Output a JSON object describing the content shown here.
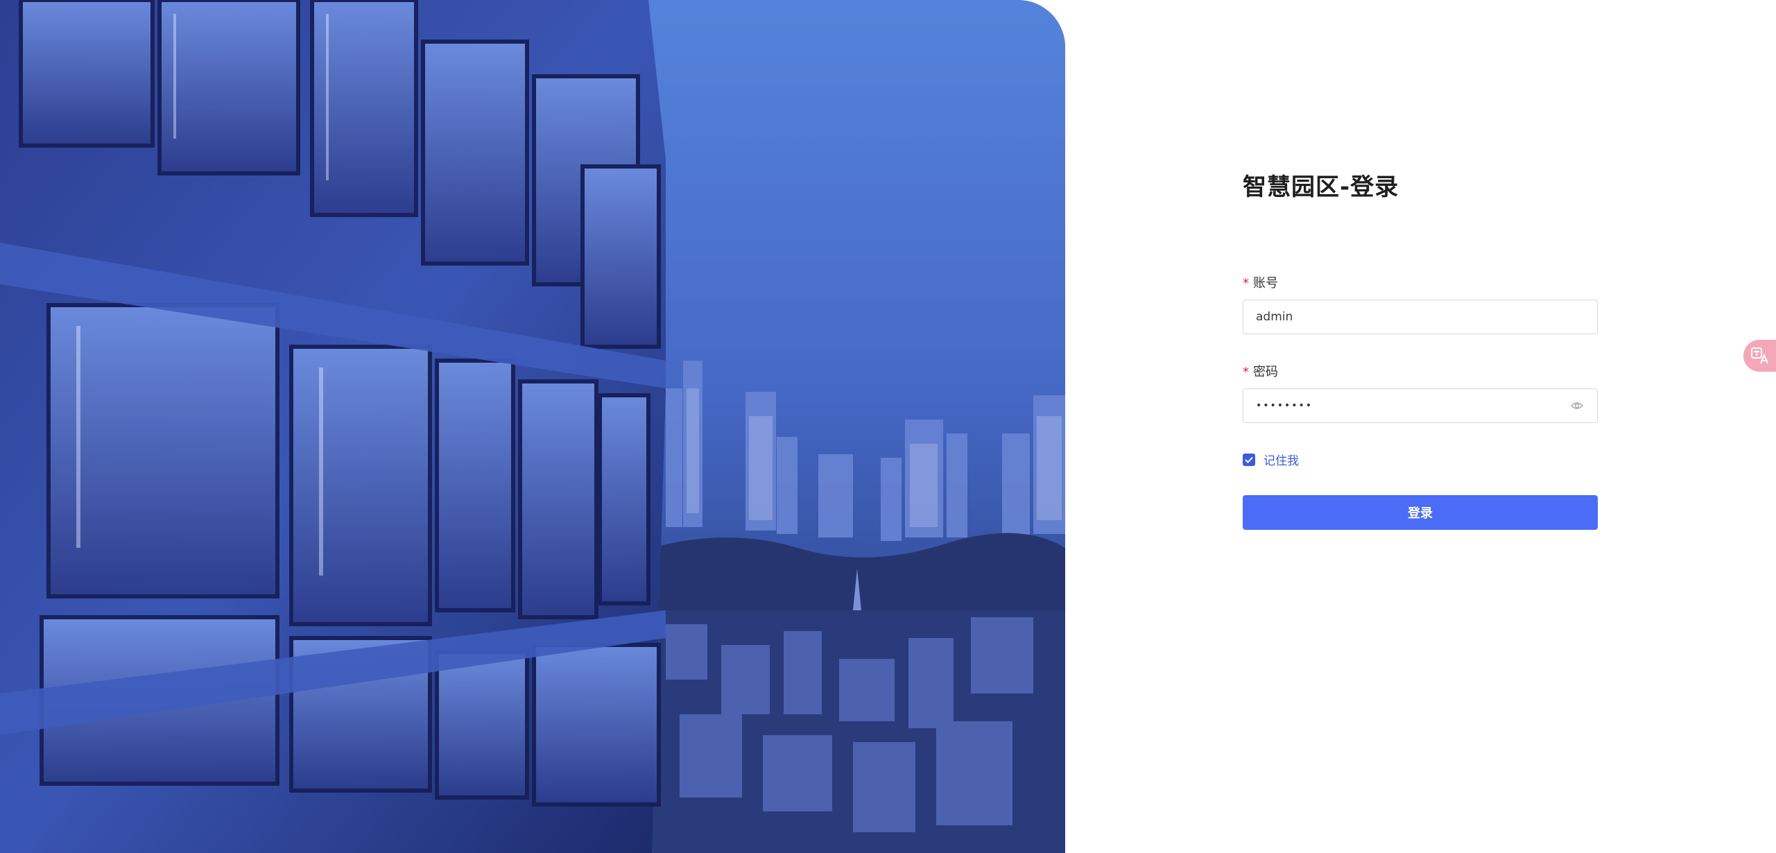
{
  "title": "智慧园区-登录",
  "form": {
    "account_label": "账号",
    "account_value": "admin",
    "password_label": "密码",
    "password_value": "••••••••",
    "required_mark": "*",
    "remember_label": "记住我",
    "remember_checked": true,
    "submit_label": "登录"
  },
  "icons": {
    "password_toggle": "eye-icon",
    "remember_checkbox": "check-icon",
    "floating_widget": "translate-icon"
  },
  "colors": {
    "primary": "#4a6cf7",
    "checkbox": "#3b5bdb",
    "required": "#f5222d",
    "title": "#1f1f1f",
    "widget": "#f3a7b8"
  }
}
